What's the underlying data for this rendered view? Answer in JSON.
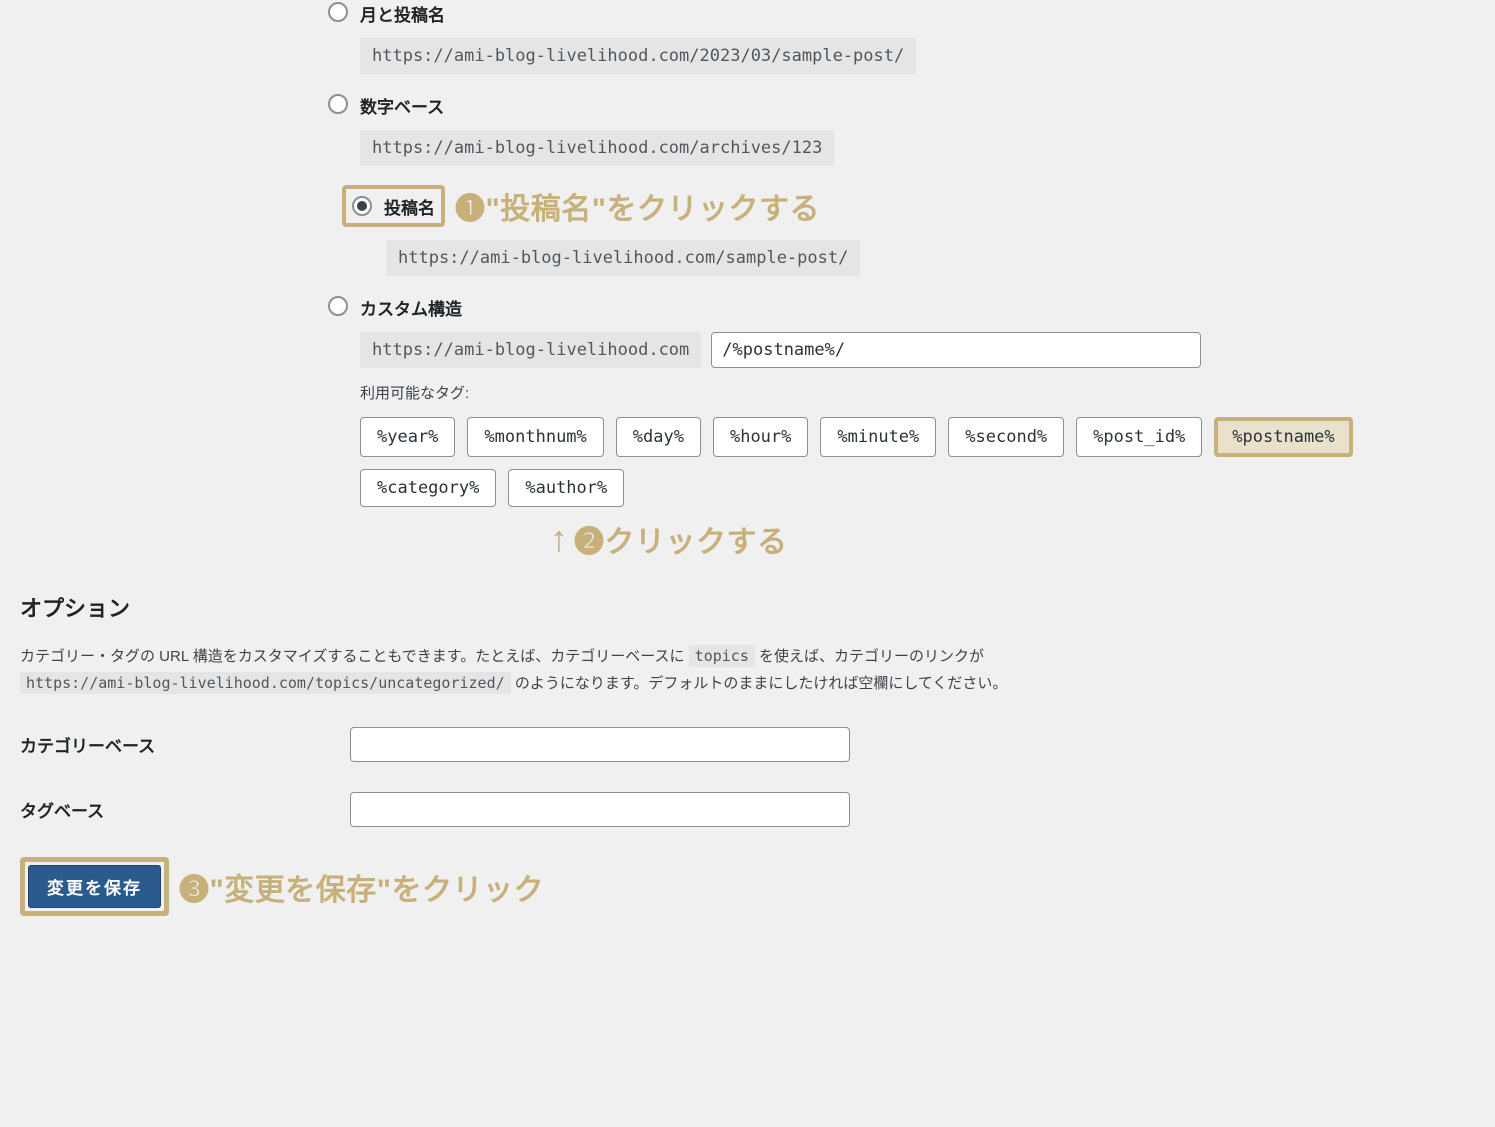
{
  "permalinks": {
    "month_name": {
      "label": "月と投稿名",
      "example": "https://ami-blog-livelihood.com/2023/03/sample-post/"
    },
    "numeric": {
      "label": "数字ベース",
      "example": "https://ami-blog-livelihood.com/archives/123"
    },
    "postname": {
      "label": "投稿名",
      "example": "https://ami-blog-livelihood.com/sample-post/"
    },
    "custom": {
      "label": "カスタム構造",
      "prefix": "https://ami-blog-livelihood.com",
      "value": "/%postname%/"
    }
  },
  "tags_label": "利用可能なタグ:",
  "tags": {
    "year": "%year%",
    "monthnum": "%monthnum%",
    "day": "%day%",
    "hour": "%hour%",
    "minute": "%minute%",
    "second": "%second%",
    "post_id": "%post_id%",
    "postname": "%postname%",
    "category": "%category%",
    "author": "%author%"
  },
  "annotations": {
    "a1": "❶\"投稿名\"をクリックする",
    "a2": "❷クリックする",
    "a3": "❸\"変更を保存\"をクリック"
  },
  "options": {
    "heading": "オプション",
    "desc_before": "カテゴリー・タグの URL 構造をカスタマイズすることもできます。たとえば、カテゴリーベースに ",
    "desc_code1": "topics",
    "desc_mid": " を使えば、カテゴリーのリンクが ",
    "desc_code2": "https://ami-blog-livelihood.com/topics/uncategorized/",
    "desc_after": " のようになります。デフォルトのままにしたければ空欄にしてください。",
    "category_base_label": "カテゴリーベース",
    "tag_base_label": "タグベース"
  },
  "save_label": "変更を保存"
}
